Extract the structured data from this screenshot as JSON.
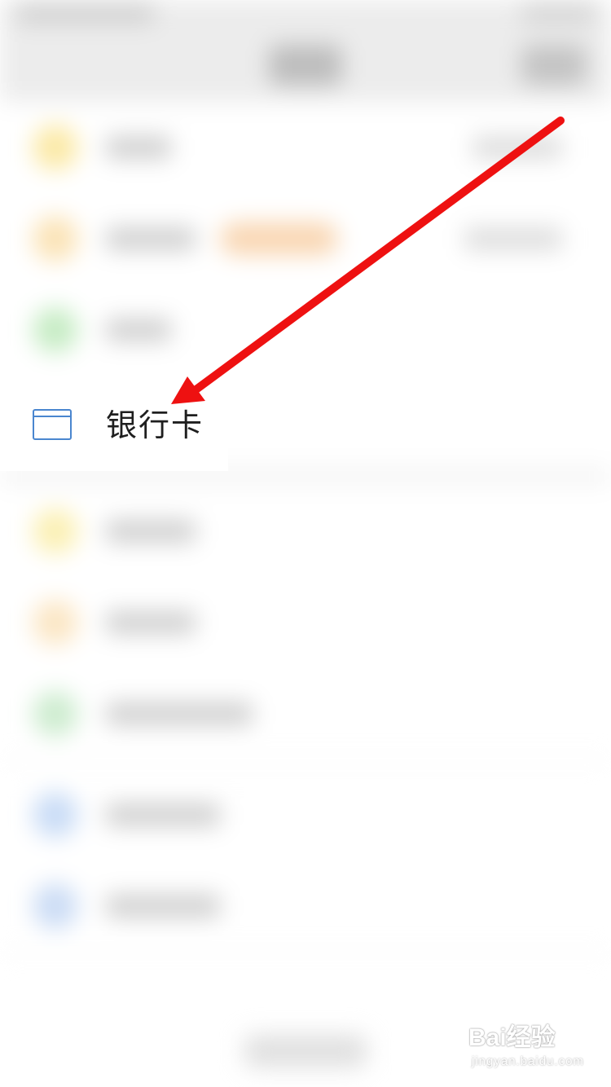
{
  "focused_item": {
    "label": "银行卡",
    "icon": "bank-card-icon",
    "icon_color": "#4a86cf"
  },
  "annotation": {
    "type": "arrow",
    "color": "#ee1111"
  },
  "watermark": {
    "brand": "Bai经验",
    "url": "jingyan.baidu.com"
  }
}
